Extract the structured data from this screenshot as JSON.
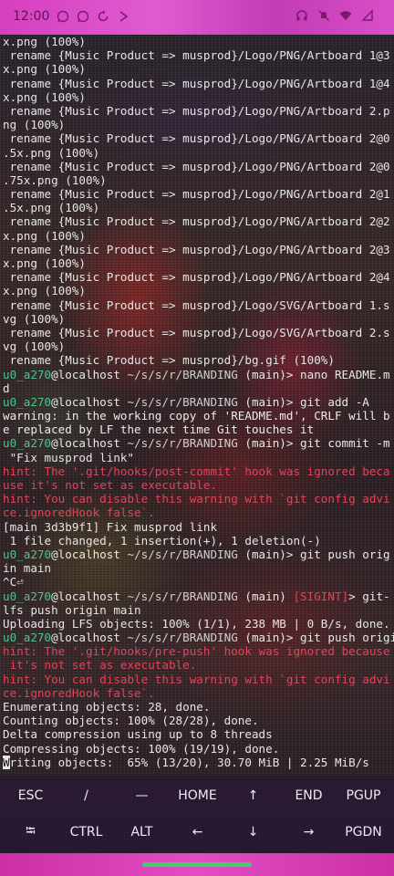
{
  "status_bar": {
    "time": "12:00",
    "left_icons": [
      "whatsapp-icon",
      "whatsapp-icon",
      "refresh-icon",
      "play-icon"
    ],
    "right_icons": [
      "headset-icon",
      "mute-icon",
      "wifi-icon",
      "signal-icon"
    ],
    "color": "#d63fbf"
  },
  "terminal": {
    "lines": [
      [
        {
          "t": "x.png (100%)",
          "c": ""
        }
      ],
      [
        {
          "t": " rename {Music Product => musprod}/Logo/PNG/Artboard 1@3",
          "c": ""
        }
      ],
      [
        {
          "t": "x.png (100%)",
          "c": ""
        }
      ],
      [
        {
          "t": " rename {Music Product => musprod}/Logo/PNG/Artboard 1@4",
          "c": ""
        }
      ],
      [
        {
          "t": "x.png (100%)",
          "c": ""
        }
      ],
      [
        {
          "t": " rename {Music Product => musprod}/Logo/PNG/Artboard 2.p",
          "c": ""
        }
      ],
      [
        {
          "t": "ng (100%)",
          "c": ""
        }
      ],
      [
        {
          "t": " rename {Music Product => musprod}/Logo/PNG/Artboard 2@0",
          "c": ""
        }
      ],
      [
        {
          "t": ".5x.png (100%)",
          "c": ""
        }
      ],
      [
        {
          "t": " rename {Music Product => musprod}/Logo/PNG/Artboard 2@0",
          "c": ""
        }
      ],
      [
        {
          "t": ".75x.png (100%)",
          "c": ""
        }
      ],
      [
        {
          "t": " rename {Music Product => musprod}/Logo/PNG/Artboard 2@1",
          "c": ""
        }
      ],
      [
        {
          "t": ".5x.png (100%)",
          "c": ""
        }
      ],
      [
        {
          "t": " rename {Music Product => musprod}/Logo/PNG/Artboard 2@2",
          "c": ""
        }
      ],
      [
        {
          "t": "x.png (100%)",
          "c": ""
        }
      ],
      [
        {
          "t": " rename {Music Product => musprod}/Logo/PNG/Artboard 2@3",
          "c": ""
        }
      ],
      [
        {
          "t": "x.png (100%)",
          "c": ""
        }
      ],
      [
        {
          "t": " rename {Music Product => musprod}/Logo/PNG/Artboard 2@4",
          "c": ""
        }
      ],
      [
        {
          "t": "x.png (100%)",
          "c": ""
        }
      ],
      [
        {
          "t": " rename {Music Product => musprod}/Logo/SVG/Artboard 1.s",
          "c": ""
        }
      ],
      [
        {
          "t": "vg (100%)",
          "c": ""
        }
      ],
      [
        {
          "t": " rename {Music Product => musprod}/Logo/SVG/Artboard 2.s",
          "c": ""
        }
      ],
      [
        {
          "t": "vg (100%)",
          "c": ""
        }
      ],
      [
        {
          "t": " rename {Music Product => musprod}/bg.gif (100%)",
          "c": ""
        }
      ],
      [
        {
          "t": "u0_a270",
          "c": "c-user"
        },
        {
          "t": "@localhost ",
          "c": "c-prompt"
        },
        {
          "t": "~/s/s/r/BRANDING ",
          "c": "c-path"
        },
        {
          "t": "(main)> nano README.m",
          "c": "c-branch"
        }
      ],
      [
        {
          "t": "d",
          "c": ""
        }
      ],
      [
        {
          "t": "u0_a270",
          "c": "c-user"
        },
        {
          "t": "@localhost ",
          "c": "c-prompt"
        },
        {
          "t": "~/s/s/r/BRANDING ",
          "c": "c-path"
        },
        {
          "t": "(main)> git add -A",
          "c": "c-branch"
        }
      ],
      [
        {
          "t": "warning: in the working copy of 'README.md', CRLF will b",
          "c": "c-warn"
        }
      ],
      [
        {
          "t": "e replaced by LF the next time Git touches it",
          "c": "c-warn"
        }
      ],
      [
        {
          "t": "u0_a270",
          "c": "c-user"
        },
        {
          "t": "@localhost ",
          "c": "c-prompt"
        },
        {
          "t": "~/s/s/r/BRANDING ",
          "c": "c-path"
        },
        {
          "t": "(main)> git commit -m",
          "c": "c-branch"
        }
      ],
      [
        {
          "t": " \"Fix musprod link\"",
          "c": ""
        }
      ],
      [
        {
          "t": "hint: The '.git/hooks/post-commit' hook was ignored beca",
          "c": "c-hint"
        }
      ],
      [
        {
          "t": "use it's not set as executable.",
          "c": "c-hint"
        }
      ],
      [
        {
          "t": "hint: You can disable this warning with `git config advi",
          "c": "c-hint"
        }
      ],
      [
        {
          "t": "ce.ignoredHook false`.",
          "c": "c-hint"
        }
      ],
      [
        {
          "t": "[main 3d3b9f1] Fix musprod link",
          "c": ""
        }
      ],
      [
        {
          "t": " 1 file changed, 1 insertion(+), 1 deletion(-)",
          "c": ""
        }
      ],
      [
        {
          "t": "u0_a270",
          "c": "c-user"
        },
        {
          "t": "@localhost ",
          "c": "c-prompt"
        },
        {
          "t": "~/s/s/r/BRANDING ",
          "c": "c-path"
        },
        {
          "t": "(main)> git push orig",
          "c": "c-branch"
        }
      ],
      [
        {
          "t": "in main",
          "c": ""
        }
      ],
      [
        {
          "t": "^C⏎",
          "c": ""
        }
      ],
      [
        {
          "t": "u0_a270",
          "c": "c-user"
        },
        {
          "t": "@localhost ",
          "c": "c-prompt"
        },
        {
          "t": "~/s/s/r/BRANDING ",
          "c": "c-path"
        },
        {
          "t": "(main) ",
          "c": "c-branch"
        },
        {
          "t": "[SIGINT]",
          "c": "c-sig"
        },
        {
          "t": "> git-",
          "c": "c-branch"
        }
      ],
      [
        {
          "t": "lfs push origin main",
          "c": ""
        }
      ],
      [
        {
          "t": "Uploading LFS objects: 100% (1/1), 238 MB | 0 B/s, done.",
          "c": ""
        }
      ],
      [
        {
          "t": "u0_a270",
          "c": "c-user"
        },
        {
          "t": "@localhost ",
          "c": "c-prompt"
        },
        {
          "t": "~/s/s/r/BRANDING ",
          "c": "c-path"
        },
        {
          "t": "(main)> git push origin main",
          "c": "c-branch"
        }
      ],
      [
        {
          "t": "hint: The '.git/hooks/pre-push' hook was ignored because",
          "c": "c-hint"
        }
      ],
      [
        {
          "t": " it's not set as executable.",
          "c": "c-hint"
        }
      ],
      [
        {
          "t": "hint: You can disable this warning with `git config advi",
          "c": "c-hint"
        }
      ],
      [
        {
          "t": "ce.ignoredHook false`.",
          "c": "c-hint"
        }
      ],
      [
        {
          "t": "Enumerating objects: 28, done.",
          "c": ""
        }
      ],
      [
        {
          "t": "Counting objects: 100% (28/28), done.",
          "c": ""
        }
      ],
      [
        {
          "t": "Delta compression using up to 8 threads",
          "c": ""
        }
      ],
      [
        {
          "t": "Compressing objects: 100% (19/19), done.",
          "c": ""
        }
      ],
      [
        {
          "t": "W",
          "c": "cursor"
        },
        {
          "t": "riting objects:  65% (13/20), 30.70 MiB | 2.25 MiB/s",
          "c": ""
        }
      ]
    ]
  },
  "extra_keys": {
    "row1": [
      "ESC",
      "/",
      "—",
      "HOME",
      "↑",
      "END",
      "PGUP"
    ],
    "row2": [
      "⭾",
      "CTRL",
      "ALT",
      "←",
      "↓",
      "→",
      "PGDN"
    ]
  }
}
